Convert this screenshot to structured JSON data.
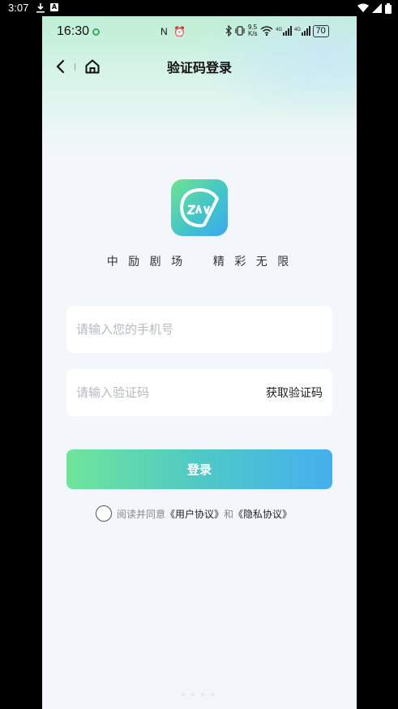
{
  "outer_status": {
    "time": "3:07"
  },
  "inner_status": {
    "time": "16:30",
    "mid_icons": "N ⏰",
    "net_speed_top": "9.5",
    "net_speed_bottom": "K/s",
    "battery": "70"
  },
  "nav": {
    "title": "验证码登录"
  },
  "brand": {
    "slogan": "中 励 剧 场    精 彩 无 限"
  },
  "form": {
    "phone_placeholder": "请输入您的手机号",
    "code_placeholder": "请输入验证码",
    "get_code_label": "获取验证码",
    "login_label": "登录"
  },
  "agreement": {
    "prefix": "阅读并同意",
    "user_link": "《用户协议》",
    "and": "和",
    "privacy_link": "《隐私协议》"
  },
  "colors": {
    "accent_green": "#6fe59a",
    "accent_blue": "#44b0ee",
    "background": "#f3f6fa"
  }
}
